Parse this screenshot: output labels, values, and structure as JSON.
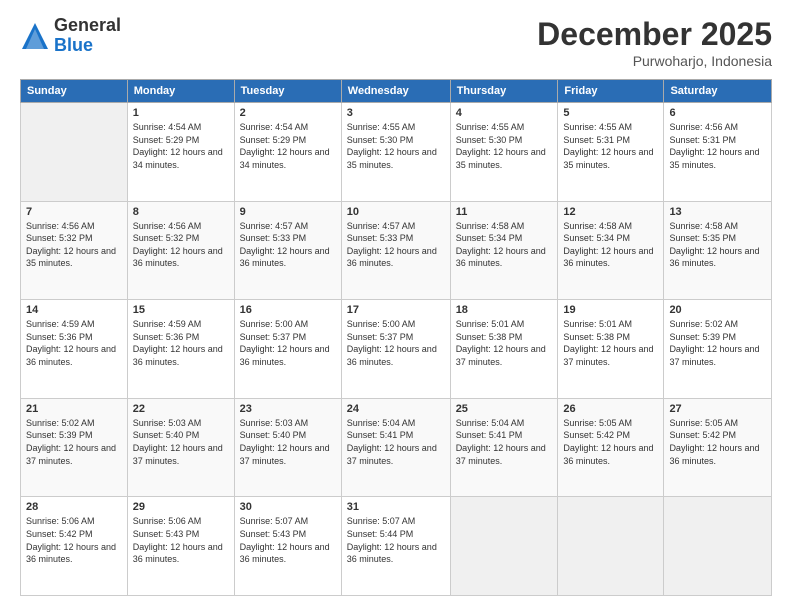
{
  "logo": {
    "general": "General",
    "blue": "Blue"
  },
  "header": {
    "month": "December 2025",
    "location": "Purwoharjo, Indonesia"
  },
  "weekdays": [
    "Sunday",
    "Monday",
    "Tuesday",
    "Wednesday",
    "Thursday",
    "Friday",
    "Saturday"
  ],
  "weeks": [
    [
      {
        "day": "",
        "sunrise": "",
        "sunset": "",
        "daylight": ""
      },
      {
        "day": "1",
        "sunrise": "Sunrise: 4:54 AM",
        "sunset": "Sunset: 5:29 PM",
        "daylight": "Daylight: 12 hours and 34 minutes."
      },
      {
        "day": "2",
        "sunrise": "Sunrise: 4:54 AM",
        "sunset": "Sunset: 5:29 PM",
        "daylight": "Daylight: 12 hours and 34 minutes."
      },
      {
        "day": "3",
        "sunrise": "Sunrise: 4:55 AM",
        "sunset": "Sunset: 5:30 PM",
        "daylight": "Daylight: 12 hours and 35 minutes."
      },
      {
        "day": "4",
        "sunrise": "Sunrise: 4:55 AM",
        "sunset": "Sunset: 5:30 PM",
        "daylight": "Daylight: 12 hours and 35 minutes."
      },
      {
        "day": "5",
        "sunrise": "Sunrise: 4:55 AM",
        "sunset": "Sunset: 5:31 PM",
        "daylight": "Daylight: 12 hours and 35 minutes."
      },
      {
        "day": "6",
        "sunrise": "Sunrise: 4:56 AM",
        "sunset": "Sunset: 5:31 PM",
        "daylight": "Daylight: 12 hours and 35 minutes."
      }
    ],
    [
      {
        "day": "7",
        "sunrise": "Sunrise: 4:56 AM",
        "sunset": "Sunset: 5:32 PM",
        "daylight": "Daylight: 12 hours and 35 minutes."
      },
      {
        "day": "8",
        "sunrise": "Sunrise: 4:56 AM",
        "sunset": "Sunset: 5:32 PM",
        "daylight": "Daylight: 12 hours and 36 minutes."
      },
      {
        "day": "9",
        "sunrise": "Sunrise: 4:57 AM",
        "sunset": "Sunset: 5:33 PM",
        "daylight": "Daylight: 12 hours and 36 minutes."
      },
      {
        "day": "10",
        "sunrise": "Sunrise: 4:57 AM",
        "sunset": "Sunset: 5:33 PM",
        "daylight": "Daylight: 12 hours and 36 minutes."
      },
      {
        "day": "11",
        "sunrise": "Sunrise: 4:58 AM",
        "sunset": "Sunset: 5:34 PM",
        "daylight": "Daylight: 12 hours and 36 minutes."
      },
      {
        "day": "12",
        "sunrise": "Sunrise: 4:58 AM",
        "sunset": "Sunset: 5:34 PM",
        "daylight": "Daylight: 12 hours and 36 minutes."
      },
      {
        "day": "13",
        "sunrise": "Sunrise: 4:58 AM",
        "sunset": "Sunset: 5:35 PM",
        "daylight": "Daylight: 12 hours and 36 minutes."
      }
    ],
    [
      {
        "day": "14",
        "sunrise": "Sunrise: 4:59 AM",
        "sunset": "Sunset: 5:36 PM",
        "daylight": "Daylight: 12 hours and 36 minutes."
      },
      {
        "day": "15",
        "sunrise": "Sunrise: 4:59 AM",
        "sunset": "Sunset: 5:36 PM",
        "daylight": "Daylight: 12 hours and 36 minutes."
      },
      {
        "day": "16",
        "sunrise": "Sunrise: 5:00 AM",
        "sunset": "Sunset: 5:37 PM",
        "daylight": "Daylight: 12 hours and 36 minutes."
      },
      {
        "day": "17",
        "sunrise": "Sunrise: 5:00 AM",
        "sunset": "Sunset: 5:37 PM",
        "daylight": "Daylight: 12 hours and 36 minutes."
      },
      {
        "day": "18",
        "sunrise": "Sunrise: 5:01 AM",
        "sunset": "Sunset: 5:38 PM",
        "daylight": "Daylight: 12 hours and 37 minutes."
      },
      {
        "day": "19",
        "sunrise": "Sunrise: 5:01 AM",
        "sunset": "Sunset: 5:38 PM",
        "daylight": "Daylight: 12 hours and 37 minutes."
      },
      {
        "day": "20",
        "sunrise": "Sunrise: 5:02 AM",
        "sunset": "Sunset: 5:39 PM",
        "daylight": "Daylight: 12 hours and 37 minutes."
      }
    ],
    [
      {
        "day": "21",
        "sunrise": "Sunrise: 5:02 AM",
        "sunset": "Sunset: 5:39 PM",
        "daylight": "Daylight: 12 hours and 37 minutes."
      },
      {
        "day": "22",
        "sunrise": "Sunrise: 5:03 AM",
        "sunset": "Sunset: 5:40 PM",
        "daylight": "Daylight: 12 hours and 37 minutes."
      },
      {
        "day": "23",
        "sunrise": "Sunrise: 5:03 AM",
        "sunset": "Sunset: 5:40 PM",
        "daylight": "Daylight: 12 hours and 37 minutes."
      },
      {
        "day": "24",
        "sunrise": "Sunrise: 5:04 AM",
        "sunset": "Sunset: 5:41 PM",
        "daylight": "Daylight: 12 hours and 37 minutes."
      },
      {
        "day": "25",
        "sunrise": "Sunrise: 5:04 AM",
        "sunset": "Sunset: 5:41 PM",
        "daylight": "Daylight: 12 hours and 37 minutes."
      },
      {
        "day": "26",
        "sunrise": "Sunrise: 5:05 AM",
        "sunset": "Sunset: 5:42 PM",
        "daylight": "Daylight: 12 hours and 36 minutes."
      },
      {
        "day": "27",
        "sunrise": "Sunrise: 5:05 AM",
        "sunset": "Sunset: 5:42 PM",
        "daylight": "Daylight: 12 hours and 36 minutes."
      }
    ],
    [
      {
        "day": "28",
        "sunrise": "Sunrise: 5:06 AM",
        "sunset": "Sunset: 5:42 PM",
        "daylight": "Daylight: 12 hours and 36 minutes."
      },
      {
        "day": "29",
        "sunrise": "Sunrise: 5:06 AM",
        "sunset": "Sunset: 5:43 PM",
        "daylight": "Daylight: 12 hours and 36 minutes."
      },
      {
        "day": "30",
        "sunrise": "Sunrise: 5:07 AM",
        "sunset": "Sunset: 5:43 PM",
        "daylight": "Daylight: 12 hours and 36 minutes."
      },
      {
        "day": "31",
        "sunrise": "Sunrise: 5:07 AM",
        "sunset": "Sunset: 5:44 PM",
        "daylight": "Daylight: 12 hours and 36 minutes."
      },
      {
        "day": "",
        "sunrise": "",
        "sunset": "",
        "daylight": ""
      },
      {
        "day": "",
        "sunrise": "",
        "sunset": "",
        "daylight": ""
      },
      {
        "day": "",
        "sunrise": "",
        "sunset": "",
        "daylight": ""
      }
    ]
  ]
}
